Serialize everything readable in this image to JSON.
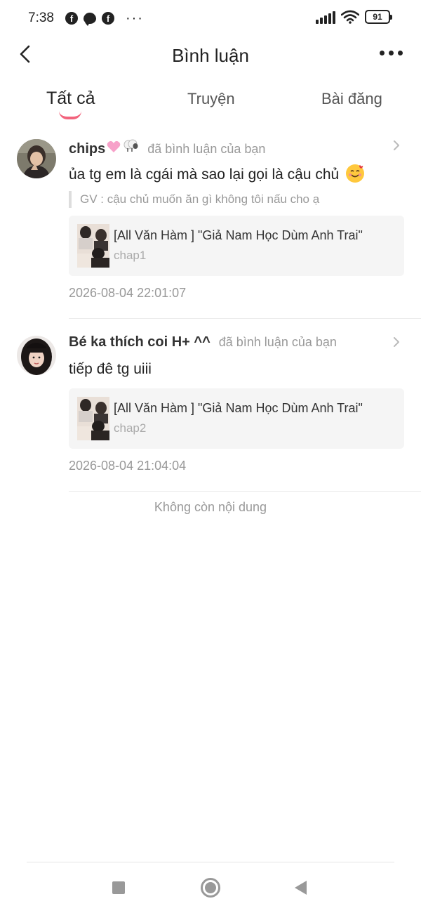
{
  "status_bar": {
    "time": "7:38",
    "battery": "91",
    "left_icons": [
      "facebook-icon",
      "messenger-icon",
      "facebook-icon",
      "more-dots-icon"
    ],
    "right_icons": [
      "signal-icon",
      "wifi-icon",
      "battery-icon"
    ]
  },
  "header": {
    "title": "Bình luận",
    "back_icon": "chevron-left-icon",
    "more_icon": "more-dots-icon"
  },
  "tabs": [
    {
      "label": "Tất cả",
      "active": true
    },
    {
      "label": "Truyện",
      "active": false
    },
    {
      "label": "Bài đăng",
      "active": false
    }
  ],
  "comments": [
    {
      "user": "chips",
      "name_emojis": [
        "pink-heart-emoji",
        "sheep-emoji"
      ],
      "action": "đã bình luận của bạn",
      "text": "ủa tg em là cgái mà sao lại gọi là cậu chủ",
      "text_emoji": "smiling-face-with-hearts-emoji",
      "quote": "GV : cậu chủ muốn ăn gì không tôi nấu cho ạ",
      "story_title": "[All Văn Hàm ] \"Giả Nam Học Dùm Anh Trai\"",
      "chapter": "chap1",
      "date": "2026-08-04 22:01:07"
    },
    {
      "user": "Bé ka thích coi H+ ^^",
      "action": "đã bình luận của bạn",
      "text": "tiếp đê tg uiii",
      "story_title": "[All Văn Hàm ] \"Giả Nam Học Dùm Anh Trai\"",
      "chapter": "chap2",
      "date": "2026-08-04 21:04:04"
    }
  ],
  "footer": {
    "no_more": "Không còn nội dung"
  },
  "nav_bar": {
    "icons": [
      "recent-apps-icon",
      "home-icon",
      "back-icon"
    ]
  },
  "colors": {
    "accent": "#f2647d",
    "secondary_text": "#999999",
    "card_background": "#f5f5f5"
  }
}
